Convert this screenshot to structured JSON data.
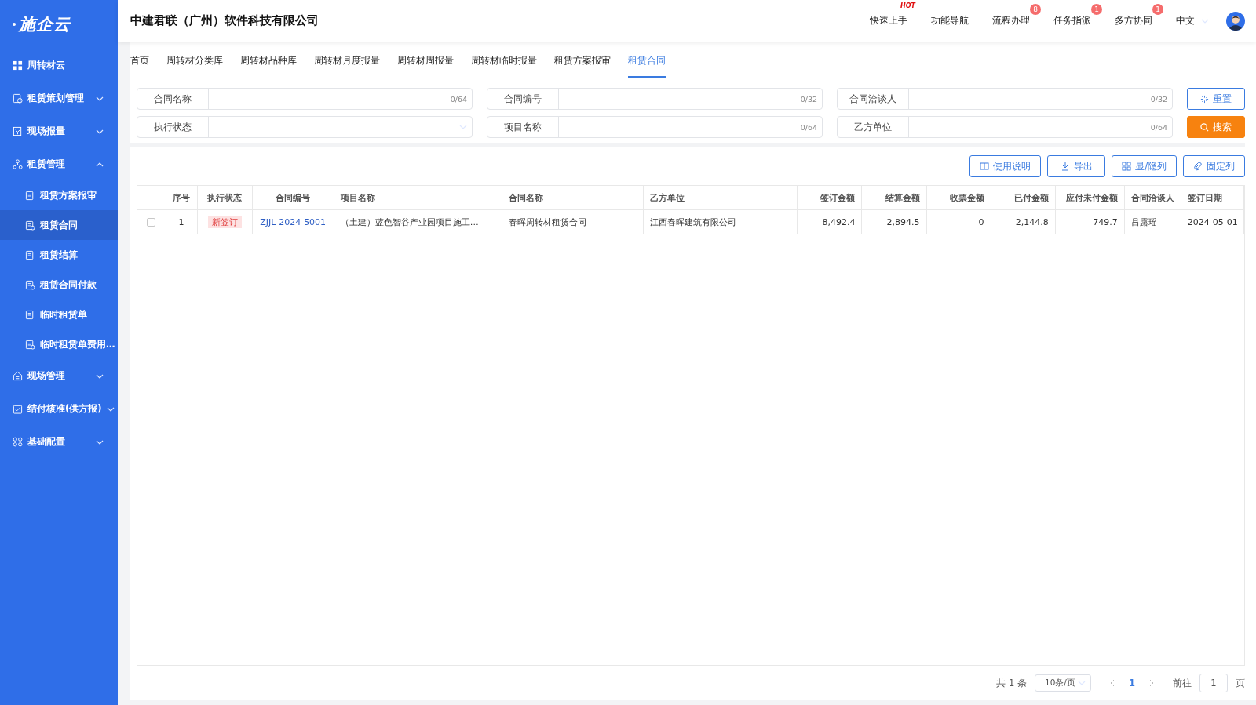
{
  "logo": {
    "text": "施企云"
  },
  "sidebar": {
    "items": [
      {
        "label": "周转材云",
        "kind": "link",
        "selected": false
      },
      {
        "label": "租赁策划管理",
        "kind": "group",
        "expanded": false,
        "selected": false
      },
      {
        "label": "现场报量",
        "kind": "group",
        "expanded": false,
        "selected": false
      },
      {
        "label": "租赁管理",
        "kind": "group",
        "expanded": true,
        "selected": false,
        "children": [
          {
            "label": "租赁方案报审",
            "selected": false
          },
          {
            "label": "租赁合同",
            "selected": true
          },
          {
            "label": "租赁结算",
            "selected": false
          },
          {
            "label": "租赁合同付款",
            "selected": false
          },
          {
            "label": "临时租赁单",
            "selected": false
          },
          {
            "label": "临时租赁单费用…",
            "selected": false
          }
        ]
      },
      {
        "label": "现场管理",
        "kind": "group",
        "expanded": false,
        "selected": false
      },
      {
        "label": "结付核准(供方报)",
        "kind": "group",
        "expanded": false,
        "selected": false
      },
      {
        "label": "基础配置",
        "kind": "group",
        "expanded": false,
        "selected": false
      }
    ]
  },
  "header": {
    "company": "中建君联（广州）软件科技有限公司",
    "nav": [
      {
        "label": "快速上手",
        "badge": "HOT",
        "kind": "hot"
      },
      {
        "label": "功能导航"
      },
      {
        "label": "流程办理",
        "badge": "8",
        "kind": "count"
      },
      {
        "label": "任务指派",
        "badge": "1",
        "kind": "count"
      },
      {
        "label": "多方协同",
        "badge": "1",
        "kind": "count"
      }
    ],
    "language": "中文"
  },
  "tabs": [
    {
      "label": "首页",
      "selected": false
    },
    {
      "label": "周转材分类库",
      "selected": false
    },
    {
      "label": "周转材品种库",
      "selected": false
    },
    {
      "label": "周转材月度报量",
      "selected": false
    },
    {
      "label": "周转材周报量",
      "selected": false
    },
    {
      "label": "周转材临时报量",
      "selected": false
    },
    {
      "label": "租赁方案报审",
      "selected": false
    },
    {
      "label": "租赁合同",
      "selected": true
    }
  ],
  "filters": [
    {
      "label": "合同名称",
      "kind": "input",
      "counter": "0/64"
    },
    {
      "label": "合同编号",
      "kind": "input",
      "counter": "0/32"
    },
    {
      "label": "合同洽谈人",
      "kind": "input",
      "counter": "0/32"
    },
    {
      "label": "执行状态",
      "kind": "select"
    },
    {
      "label": "项目名称",
      "kind": "input",
      "counter": "0/64"
    },
    {
      "label": "乙方单位",
      "kind": "input",
      "counter": "0/64"
    }
  ],
  "filter_buttons": [
    {
      "label": "重置",
      "kind": "reset"
    },
    {
      "label": "搜索",
      "kind": "search"
    }
  ],
  "toolbar": [
    {
      "label": "使用说明",
      "kind": "book"
    },
    {
      "label": "导出",
      "kind": "download"
    },
    {
      "label": "显/隐列",
      "kind": "grid"
    },
    {
      "label": "固定列",
      "kind": "clip"
    }
  ],
  "table": {
    "columns": [
      "序号",
      "执行状态",
      "合同编号",
      "项目名称",
      "合同名称",
      "乙方单位",
      "签订金额",
      "结算金额",
      "收票金额",
      "已付金额",
      "应付未付金额",
      "合同洽谈人",
      "签订日期"
    ],
    "rows": [
      {
        "checked": false,
        "cells": [
          "1",
          "新签订",
          "ZJJL-2024-5001",
          "（土建）蓝色智谷产业园项目施工…",
          "春晖周转材租赁合同",
          "江西春晖建筑有限公司",
          "8,492.4",
          "2,894.5",
          "0",
          "2,144.8",
          "749.7",
          "吕露瑶",
          "2024-05-01"
        ]
      }
    ]
  },
  "pagination": {
    "total": "共 1 条",
    "page_size": "10条/页",
    "pages": [
      {
        "label": "1",
        "selected": true
      }
    ],
    "goto_label": "前往",
    "goto_value": "1",
    "goto_suffix": "页"
  }
}
